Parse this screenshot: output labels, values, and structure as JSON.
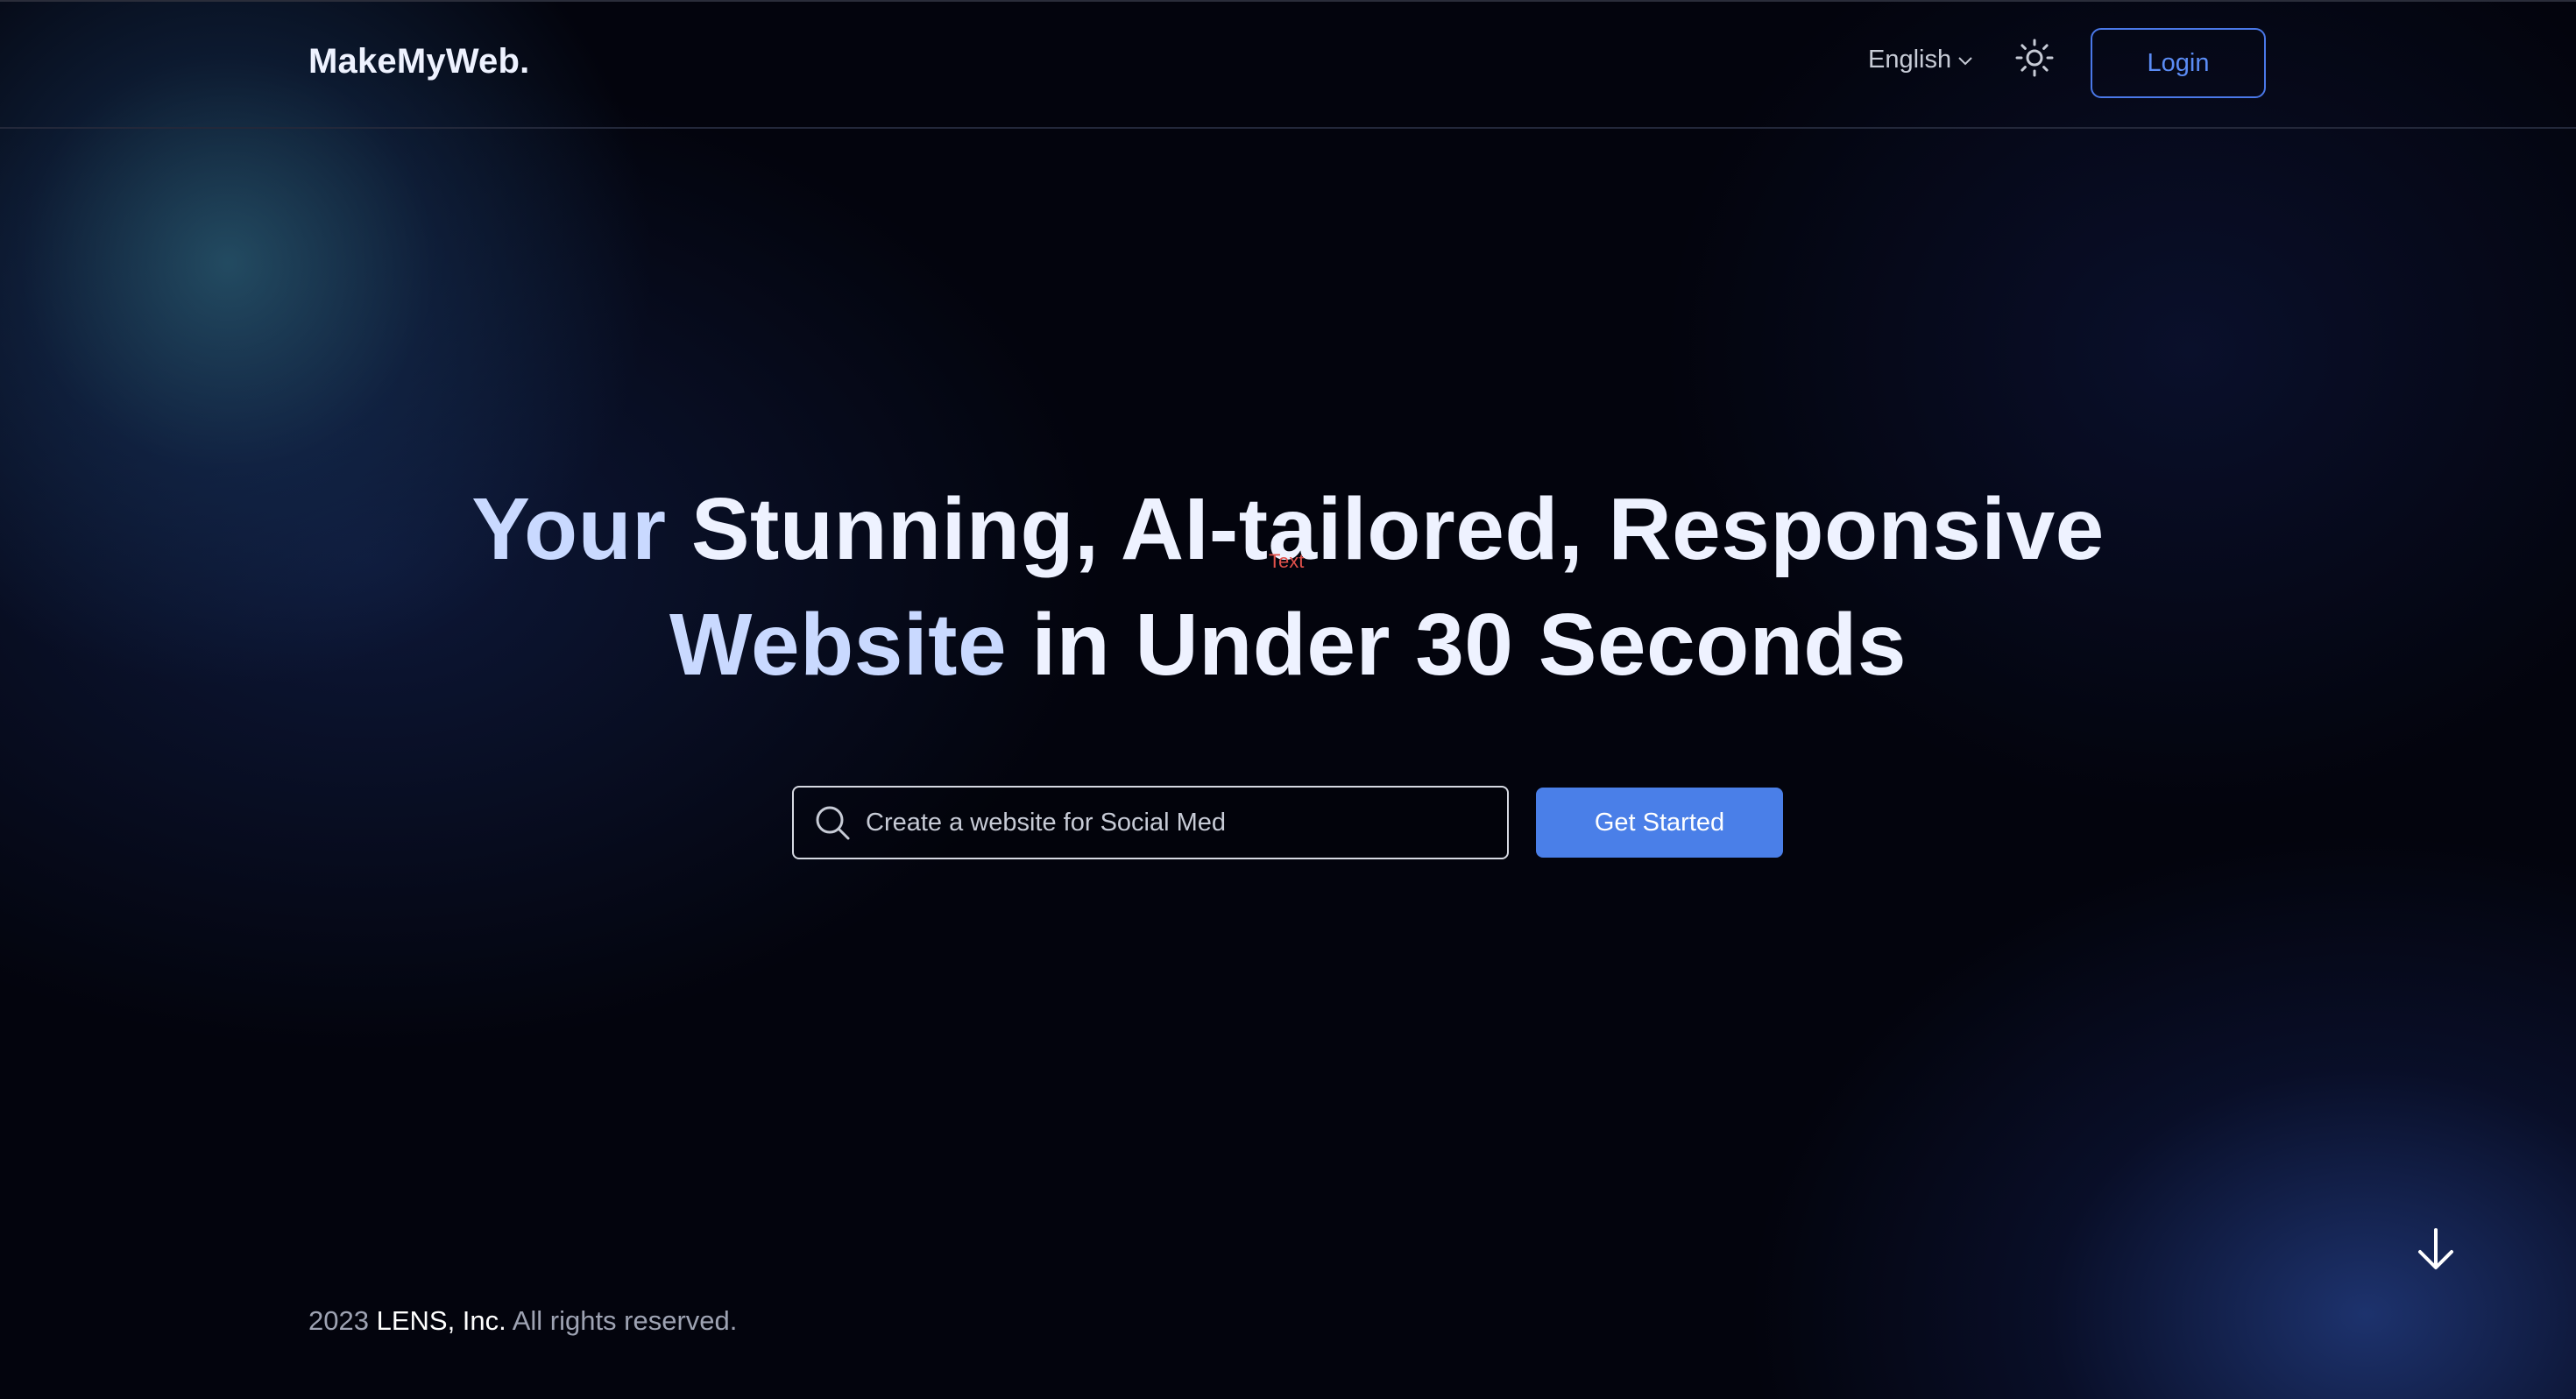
{
  "header": {
    "brand": "MakeMyWeb.",
    "language": "English",
    "login_label": "Login"
  },
  "hero": {
    "line1_accent": "Your",
    "line1_rest": " Stunning, AI-tailored, Responsive",
    "line2_accent": "Website",
    "line2_rest": " in Under 30 Seconds",
    "overlay_tag": "Text"
  },
  "search": {
    "value": "Create a website for Social Med",
    "placeholder": "Create a website for Social Med",
    "button_label": "Get Started"
  },
  "footer": {
    "year": "2023",
    "company": "LENS, Inc.",
    "rights": "All rights reserved."
  },
  "colors": {
    "background": "#03040d",
    "accent": "#4a7fe8",
    "login_border": "#4a78e8"
  },
  "icons": {
    "language": "chevron-down-icon",
    "theme": "sun-icon",
    "search": "search-icon",
    "scroll": "arrow-down-icon"
  }
}
